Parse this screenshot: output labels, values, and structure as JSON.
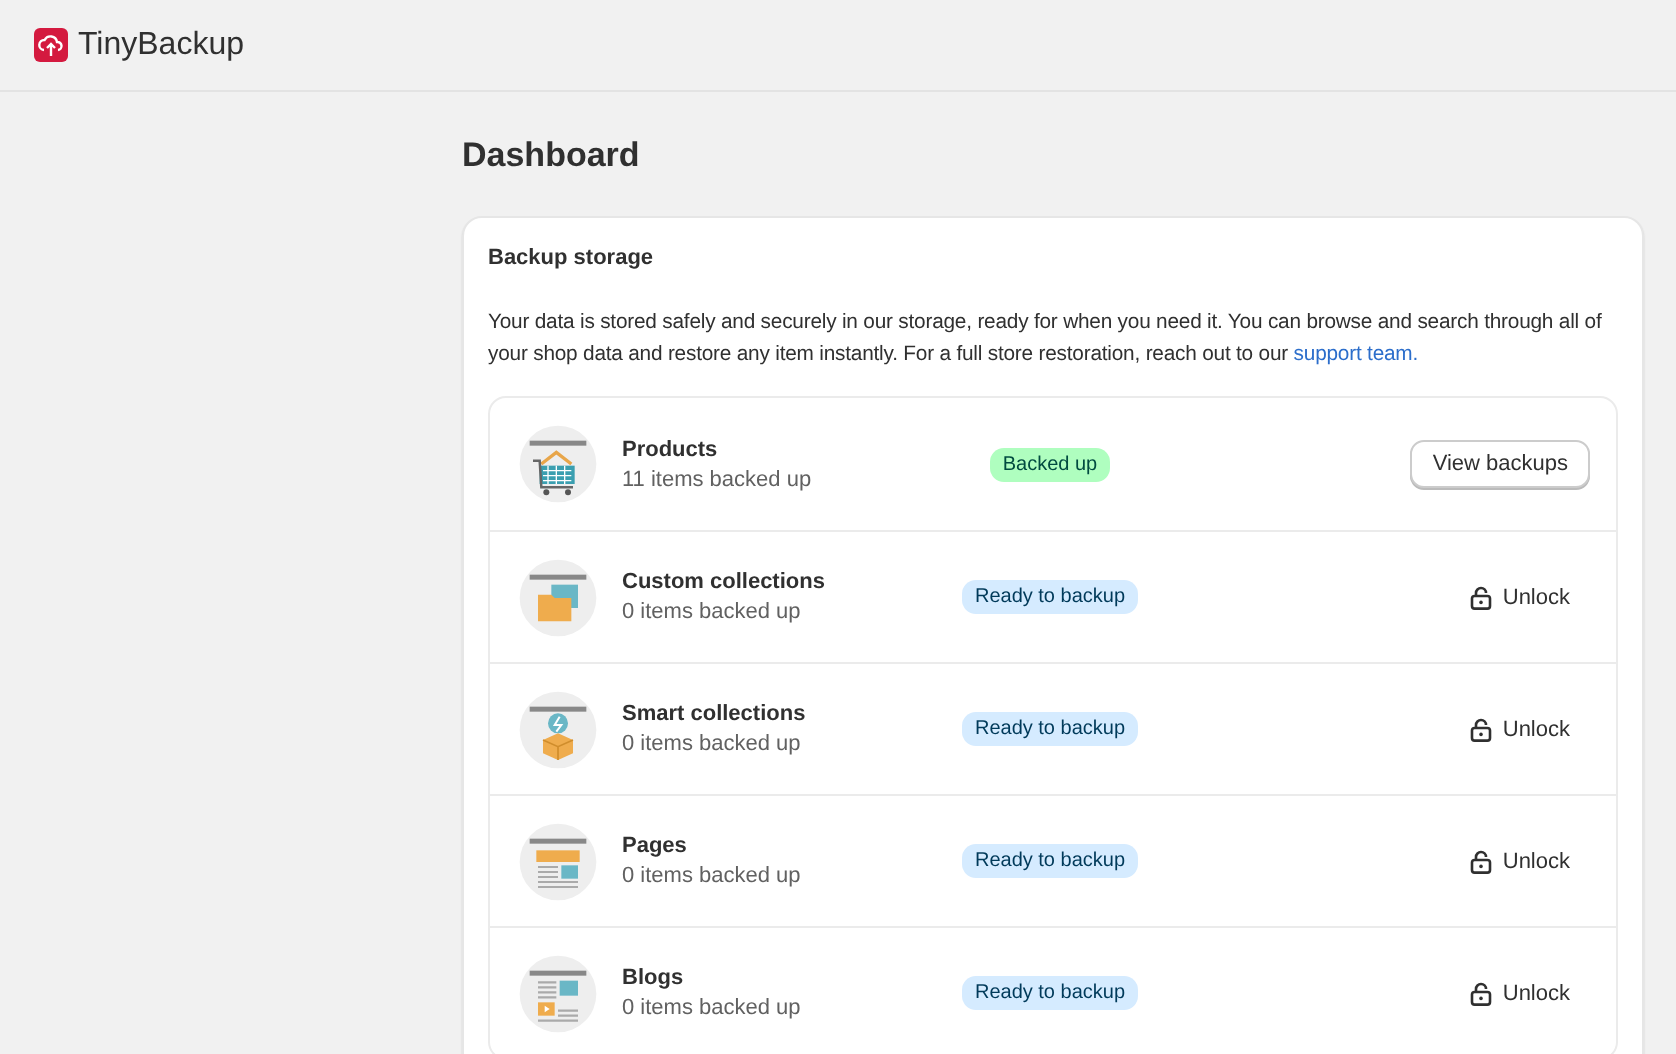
{
  "app": {
    "name": "TinyBackup"
  },
  "page": {
    "title": "Dashboard"
  },
  "storage_card": {
    "title": "Backup storage",
    "description": "Your data is stored safely and securely in our storage, ready for when you need it. You can browse and search through all of your shop data and restore any item instantly. For a full store restoration, reach out to our",
    "link": "support team."
  },
  "items": [
    {
      "name": "Products",
      "count": "11 items backed up",
      "kind": "cart",
      "status": {
        "kind": "backed",
        "label": "Backed up"
      },
      "action": {
        "kind": "button",
        "label": "View backups"
      }
    },
    {
      "name": "Custom collections",
      "count": "0 items backed up",
      "kind": "folder",
      "status": {
        "kind": "ready",
        "label": "Ready to backup"
      },
      "action": {
        "kind": "unlock",
        "label": "Unlock"
      }
    },
    {
      "name": "Smart collections",
      "count": "0 items backed up",
      "kind": "box",
      "status": {
        "kind": "ready",
        "label": "Ready to backup"
      },
      "action": {
        "kind": "unlock",
        "label": "Unlock"
      }
    },
    {
      "name": "Pages",
      "count": "0 items backed up",
      "kind": "page",
      "status": {
        "kind": "ready",
        "label": "Ready to backup"
      },
      "action": {
        "kind": "unlock",
        "label": "Unlock"
      }
    },
    {
      "name": "Blogs",
      "count": "0 items backed up",
      "kind": "blog",
      "status": {
        "kind": "ready",
        "label": "Ready to backup"
      },
      "action": {
        "kind": "unlock",
        "label": "Unlock"
      }
    }
  ]
}
